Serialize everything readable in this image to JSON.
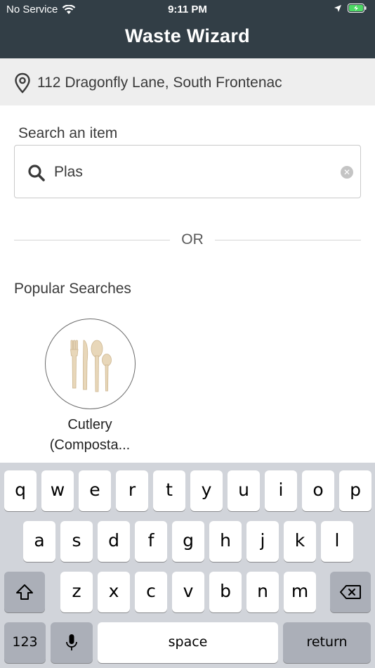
{
  "status_bar": {
    "carrier": "No Service",
    "time": "9:11 PM"
  },
  "header": {
    "title": "Waste Wizard"
  },
  "address": {
    "text": "112 Dragonfly Lane, South Frontenac",
    "icon": "location-pin-icon"
  },
  "search": {
    "label": "Search an item",
    "value": "Plas",
    "icon": "search-icon",
    "clear_icon": "clear-icon"
  },
  "divider": {
    "or_text": "OR"
  },
  "popular": {
    "label": "Popular Searches",
    "items": [
      {
        "line1": "Cutlery",
        "line2": "(Composta..."
      }
    ]
  },
  "keyboard": {
    "row1": [
      "q",
      "w",
      "e",
      "r",
      "t",
      "y",
      "u",
      "i",
      "o",
      "p"
    ],
    "row2": [
      "a",
      "s",
      "d",
      "f",
      "g",
      "h",
      "j",
      "k",
      "l"
    ],
    "row3": [
      "z",
      "x",
      "c",
      "v",
      "b",
      "n",
      "m"
    ],
    "numbers_label": "123",
    "space_label": "space",
    "return_label": "return"
  },
  "colors": {
    "header_bg": "#323e46",
    "address_bg": "#eeeeee",
    "keyboard_bg": "#d1d4da"
  }
}
